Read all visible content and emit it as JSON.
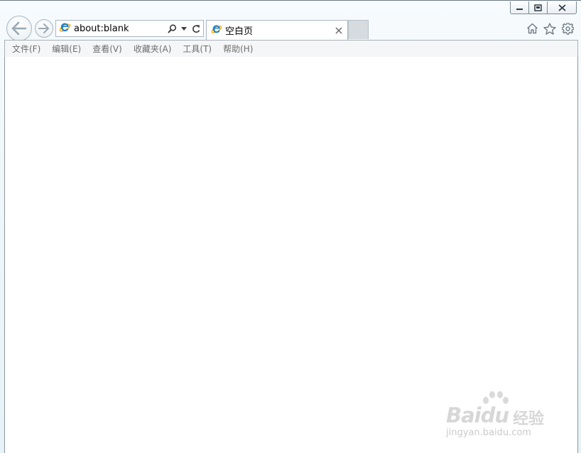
{
  "window": {
    "caption_buttons": [
      "minimize",
      "restore",
      "close"
    ]
  },
  "nav": {
    "back_icon": "back-arrow-icon",
    "forward_icon": "forward-arrow-icon"
  },
  "address": {
    "url": "about:blank",
    "site_icon": "ie-logo-icon",
    "tools": [
      "search-icon",
      "dropdown-arrow-icon",
      "refresh-icon"
    ]
  },
  "tabs": [
    {
      "label": "空白页",
      "icon": "ie-logo-icon",
      "close": "×"
    }
  ],
  "toolbar_right": [
    "home-icon",
    "favorites-star-icon",
    "settings-gear-icon"
  ],
  "menu": {
    "items": [
      "文件(F)",
      "编辑(E)",
      "查看(V)",
      "收藏夹(A)",
      "工具(T)",
      "帮助(H)"
    ]
  },
  "watermark": {
    "brand": "Baidu",
    "brand_cn": "经验",
    "url": "jingyan.baidu.com"
  },
  "colors": {
    "chrome_bg": "#eef6fa",
    "border": "#aab7c2",
    "menu_text": "#6d6d6d",
    "ie_blue": "#1e7fd0",
    "ie_gold": "#f2b31b"
  }
}
